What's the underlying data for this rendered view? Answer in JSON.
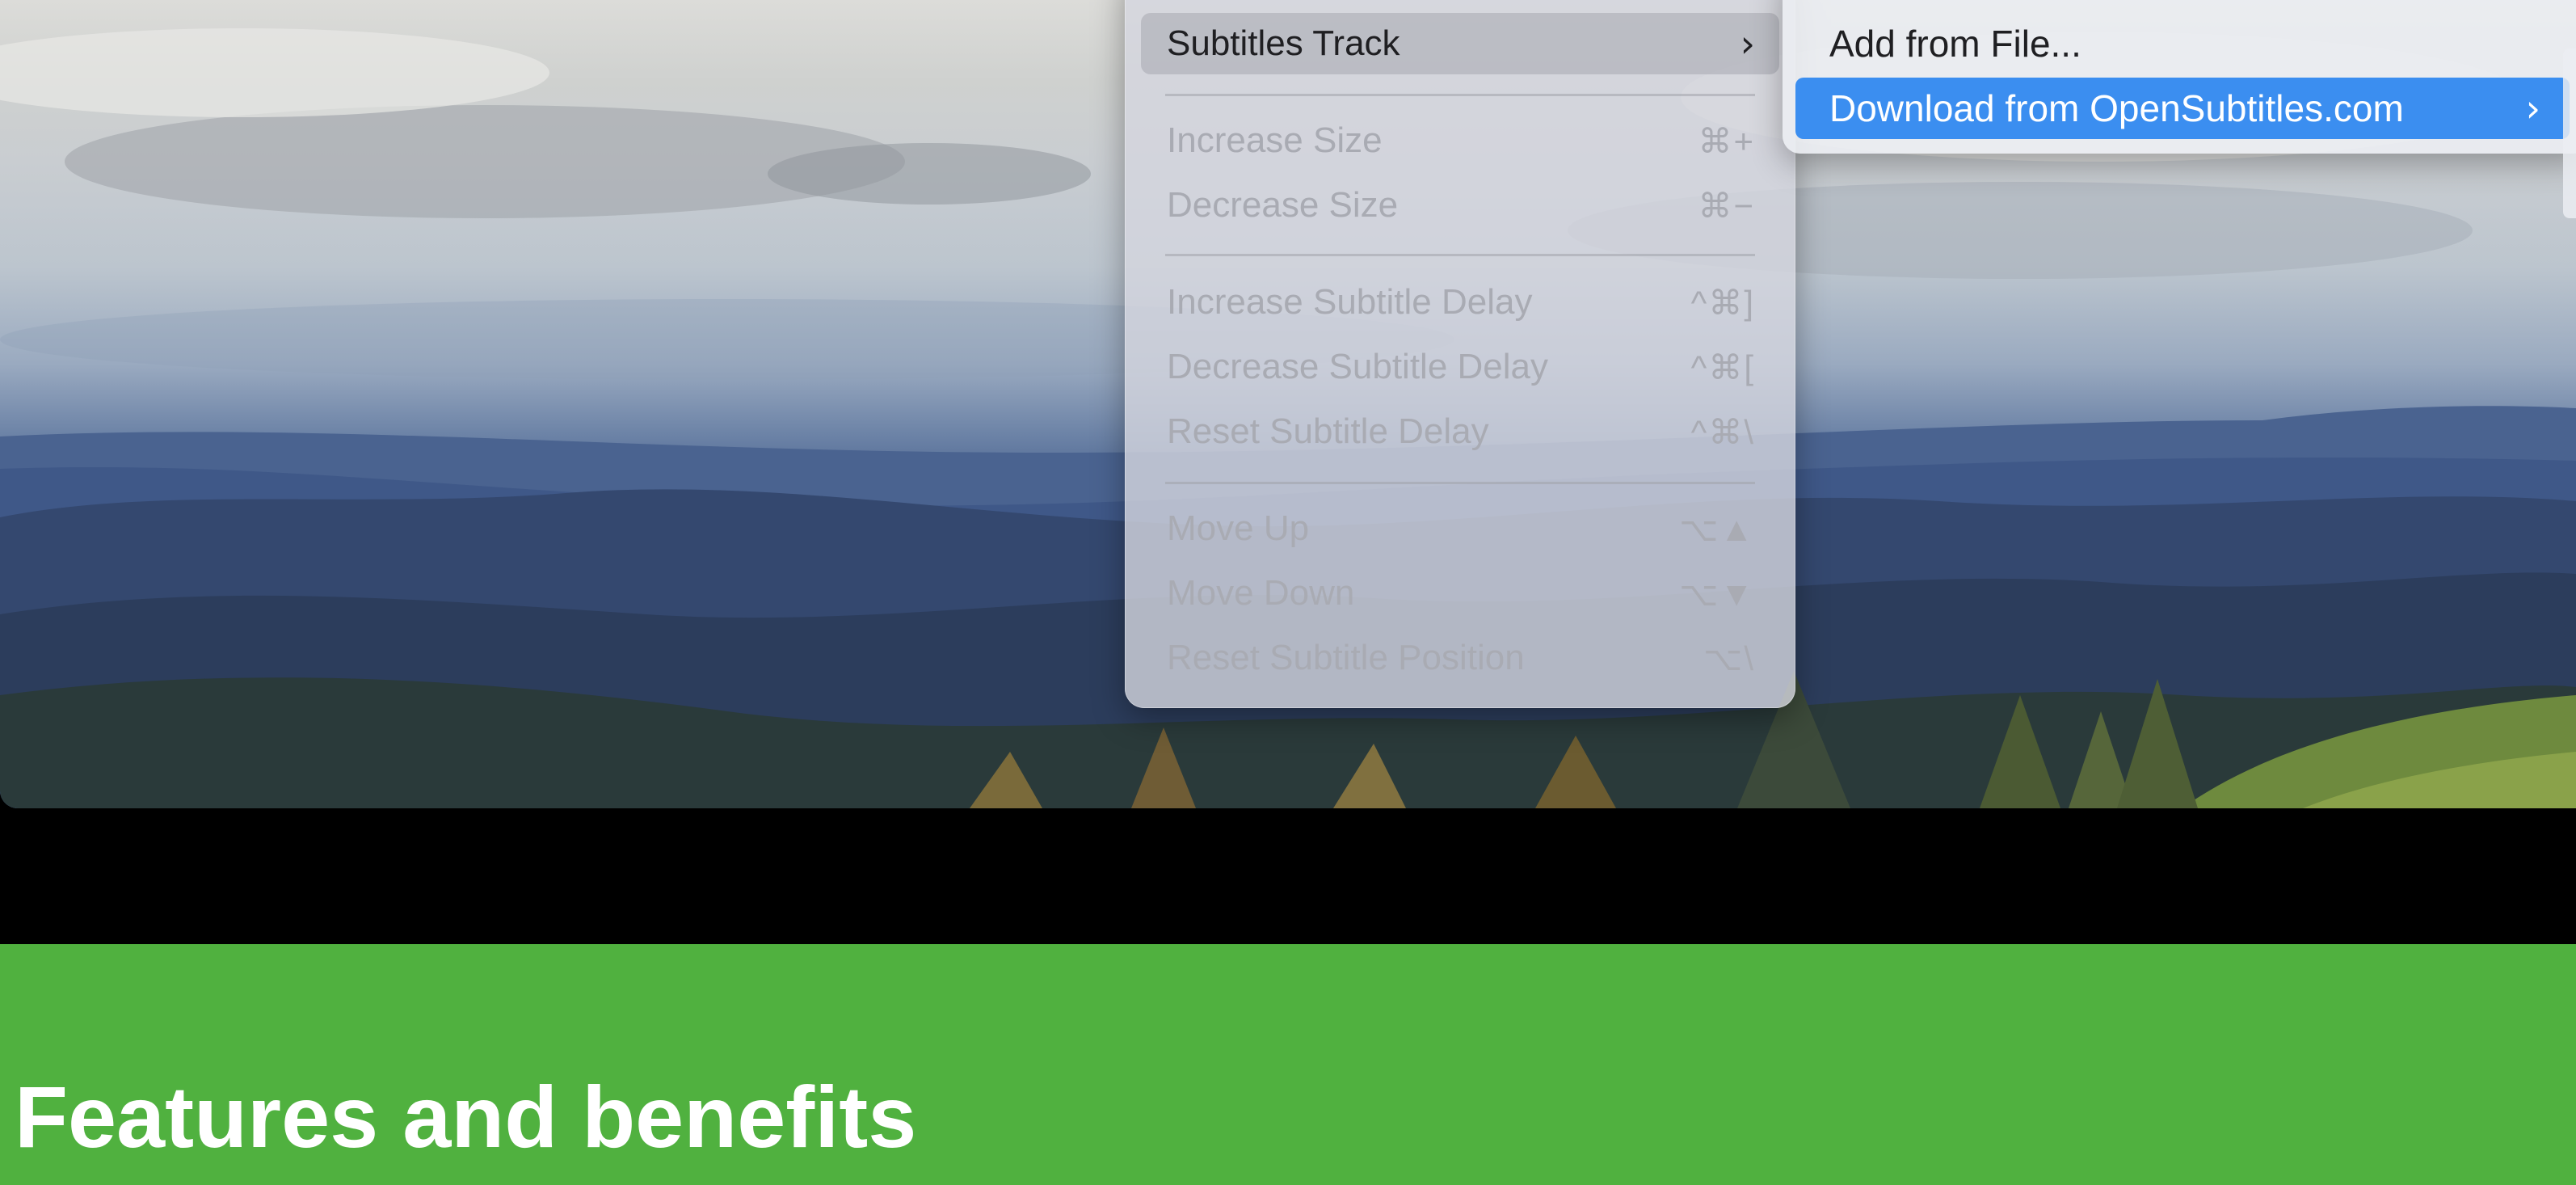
{
  "menu": {
    "items": [
      {
        "label": "Subtitles Track",
        "shortcut": "",
        "enabled": true,
        "has_submenu": true
      },
      {
        "label": "Increase Size",
        "shortcut": "⌘+",
        "enabled": false
      },
      {
        "label": "Decrease Size",
        "shortcut": "⌘−",
        "enabled": false
      },
      {
        "label": "Increase Subtitle Delay",
        "shortcut": "^⌘]",
        "enabled": false
      },
      {
        "label": "Decrease Subtitle Delay",
        "shortcut": "^⌘[",
        "enabled": false
      },
      {
        "label": "Reset Subtitle Delay",
        "shortcut": "^⌘\\",
        "enabled": false
      },
      {
        "label": "Move Up",
        "shortcut": "⌥▲",
        "enabled": false
      },
      {
        "label": "Move Down",
        "shortcut": "⌥▼",
        "enabled": false
      },
      {
        "label": "Reset Subtitle Position",
        "shortcut": "⌥\\",
        "enabled": false
      }
    ],
    "submenu_chevron": "›"
  },
  "submenu": {
    "items": [
      {
        "label": "Add from File...",
        "selected": false
      },
      {
        "label": "Download from OpenSubtitles.com",
        "selected": true,
        "has_submenu": true
      }
    ],
    "chevron": "›"
  },
  "banner": {
    "heading": "Features and benefits",
    "color": "#50b13f"
  }
}
